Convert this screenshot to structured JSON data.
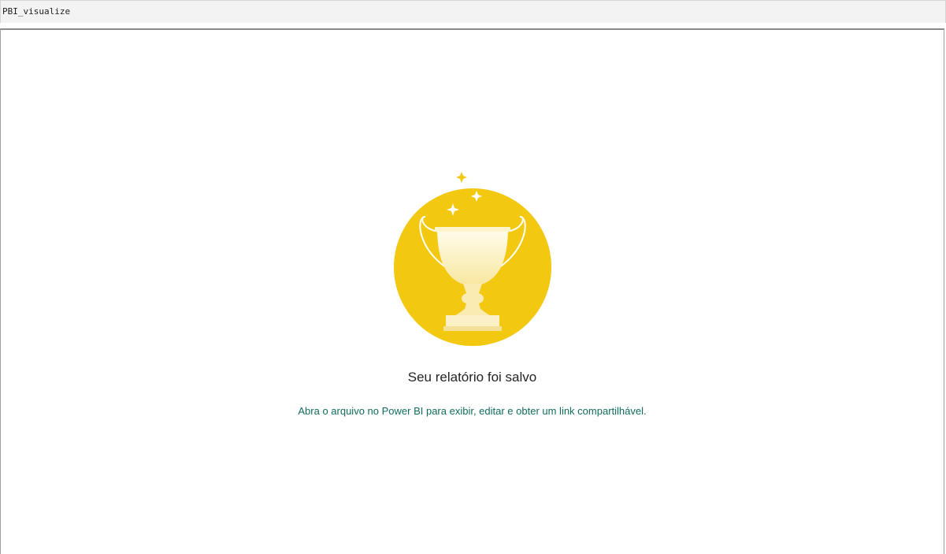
{
  "cell": {
    "label": "PBI_visualize"
  },
  "dialog": {
    "illustration_icon": "trophy-icon",
    "title": "Seu relatório foi salvo",
    "message": "Abra o arquivo no Power BI para exibir, editar e obter um link compartilhável."
  },
  "colors": {
    "circle": "#f2c811",
    "trophy_light": "#fdf4cc",
    "trophy_shade": "#f6e6a2",
    "sparkle": "#f2c811",
    "message_text": "#106c5b",
    "title_text": "#252423"
  }
}
